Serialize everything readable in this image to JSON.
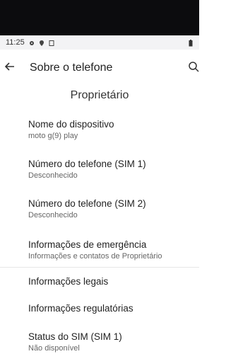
{
  "status_bar": {
    "time": "11:25"
  },
  "app_bar": {
    "title": "Sobre o telefone"
  },
  "section": {
    "owner_label": "Proprietário"
  },
  "items": [
    {
      "title": "Nome do dispositivo",
      "subtitle": "moto g(9) play"
    },
    {
      "title": "Número do telefone (SIM 1)",
      "subtitle": "Desconhecido"
    },
    {
      "title": "Número do telefone (SIM 2)",
      "subtitle": "Desconhecido"
    },
    {
      "title": "Informações de emergência",
      "subtitle": "Informações e contatos de Proprietário"
    },
    {
      "title": "Informações legais"
    },
    {
      "title": "Informações regulatórias"
    },
    {
      "title": "Status do SIM (SIM 1)",
      "subtitle": "Não disponível"
    }
  ],
  "icons": {
    "back": "arrow-back-icon",
    "search": "search-icon",
    "settings": "gear-icon",
    "location": "location-icon",
    "battery": "battery-icon"
  }
}
